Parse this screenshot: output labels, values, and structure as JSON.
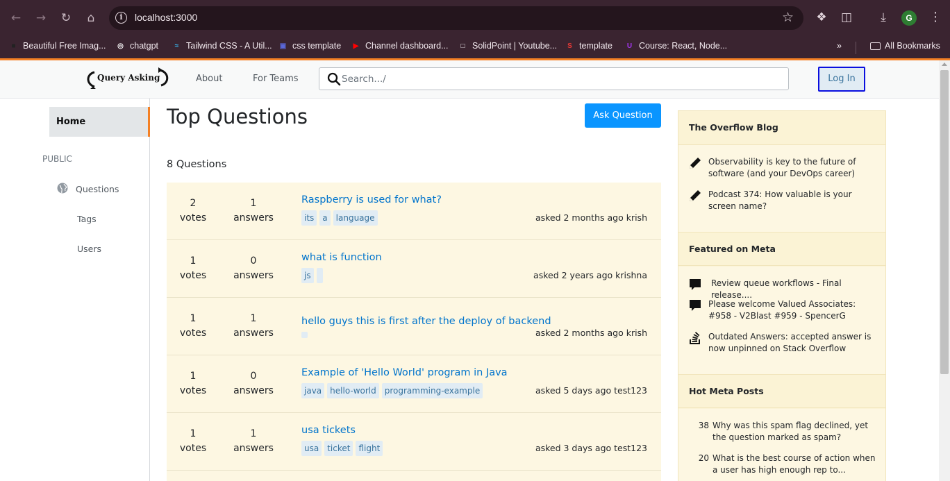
{
  "browser": {
    "url": "localhost:3000",
    "profile_initial": "G",
    "bookmarks": [
      {
        "label": "Beautiful Free Imag...",
        "icon": "unsplash-icon",
        "color": "#222222"
      },
      {
        "label": "chatgpt",
        "icon": "openai-icon",
        "color": "#ffffff"
      },
      {
        "label": "Tailwind CSS - A Util...",
        "icon": "tailwind-icon",
        "color": "#38bdf8"
      },
      {
        "label": "css template",
        "icon": "template-icon",
        "color": "#5a67d8"
      },
      {
        "label": "Channel dashboard...",
        "icon": "youtube-icon",
        "color": "#ff0000"
      },
      {
        "label": "SolidPoint | Youtube...",
        "icon": "solidpoint-icon",
        "color": "#ffffff"
      },
      {
        "label": "template",
        "icon": "s-icon",
        "color": "#e53935"
      },
      {
        "label": "Course: React, Node...",
        "icon": "udemy-icon",
        "color": "#a435f0"
      }
    ],
    "all_bookmarks_label": "All Bookmarks"
  },
  "header": {
    "logo_text": "Query Asking",
    "nav": [
      "About",
      "For Teams"
    ],
    "search_placeholder": "Search.../",
    "login_label": "Log In"
  },
  "sidebar": {
    "home": "Home",
    "section": "PUBLIC",
    "items": [
      "Questions",
      "Tags",
      "Users"
    ]
  },
  "main": {
    "title": "Top Questions",
    "ask_button": "Ask Question",
    "count_label": "8 Questions",
    "questions": [
      {
        "votes": "2",
        "votes_label": "votes",
        "answers": "1",
        "answers_label": "answers",
        "title": "Raspberry is used for what?",
        "tags": [
          "its",
          "a",
          "language"
        ],
        "asked": "asked 2 months ago krish"
      },
      {
        "votes": "1",
        "votes_label": "votes",
        "answers": "0",
        "answers_label": "answers",
        "title": "what is function",
        "tags": [
          "js",
          ""
        ],
        "asked": "asked 2 years ago krishna"
      },
      {
        "votes": "1",
        "votes_label": "votes",
        "answers": "1",
        "answers_label": "answers",
        "title": "hello guys this is first after the deploy of backend",
        "tags": [
          ""
        ],
        "asked": "asked 2 months ago krish"
      },
      {
        "votes": "1",
        "votes_label": "votes",
        "answers": "0",
        "answers_label": "answers",
        "title": "Example of 'Hello World' program in Java",
        "tags": [
          "java",
          "hello-world",
          "programming-example"
        ],
        "asked": "asked 5 days ago test123"
      },
      {
        "votes": "1",
        "votes_label": "votes",
        "answers": "1",
        "answers_label": "answers",
        "title": "usa tickets",
        "tags": [
          "usa",
          "ticket",
          "flight"
        ],
        "asked": "asked 3 days ago test123"
      }
    ]
  },
  "widget": {
    "blog_title": "The Overflow Blog",
    "blog_items": [
      {
        "icon": "pencil-icon",
        "text": "Observability is key to the future of software (and your DevOps career)"
      },
      {
        "icon": "pencil-icon",
        "text": "Podcast 374: How valuable is your screen name?"
      }
    ],
    "meta_title": "Featured on Meta",
    "meta_items": [
      {
        "icon": "speech-bubble-icon",
        "text": "Review queue workflows - Final release...."
      },
      {
        "icon": "speech-bubble-icon",
        "text": "Please welcome Valued Associates: #958 - V2Blast #959 - SpencerG"
      },
      {
        "icon": "stack-overflow-icon",
        "text": "Outdated Answers: accepted answer is now unpinned on Stack Overflow"
      }
    ],
    "hot_title": "Hot Meta Posts",
    "hot_items": [
      {
        "count": "38",
        "text": "Why was this spam flag declined, yet the question marked as spam?"
      },
      {
        "count": "20",
        "text": "What is the best course of action when a user has high enough rep to..."
      }
    ]
  },
  "colors": {
    "accent": "#f48024",
    "link": "#0074cc",
    "primary_button": "#0a95ff",
    "question_bg": "#fdf7e2",
    "widget_bg": "#fbf3d5"
  }
}
